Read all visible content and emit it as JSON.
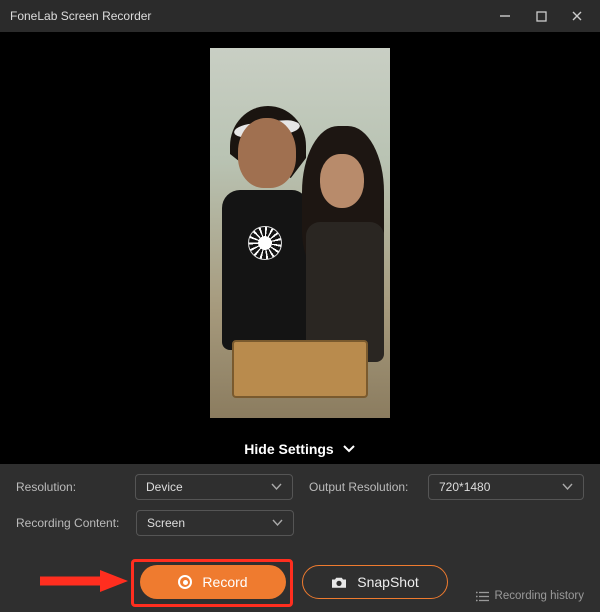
{
  "titlebar": {
    "title": "FoneLab Screen Recorder"
  },
  "toggle": {
    "hide_settings": "Hide Settings"
  },
  "settings": {
    "resolution_label": "Resolution:",
    "resolution_value": "Device",
    "output_resolution_label": "Output Resolution:",
    "output_resolution_value": "720*1480",
    "recording_content_label": "Recording Content:",
    "recording_content_value": "Screen"
  },
  "actions": {
    "record": "Record",
    "snapshot": "SnapShot",
    "recording_history": "Recording history"
  },
  "icons": {
    "minimize": "minimize-icon",
    "maximize": "maximize-icon",
    "close": "close-icon",
    "chevron_down": "chevron-down-icon",
    "record": "record-dot-icon",
    "camera": "camera-icon",
    "list": "list-icon"
  }
}
